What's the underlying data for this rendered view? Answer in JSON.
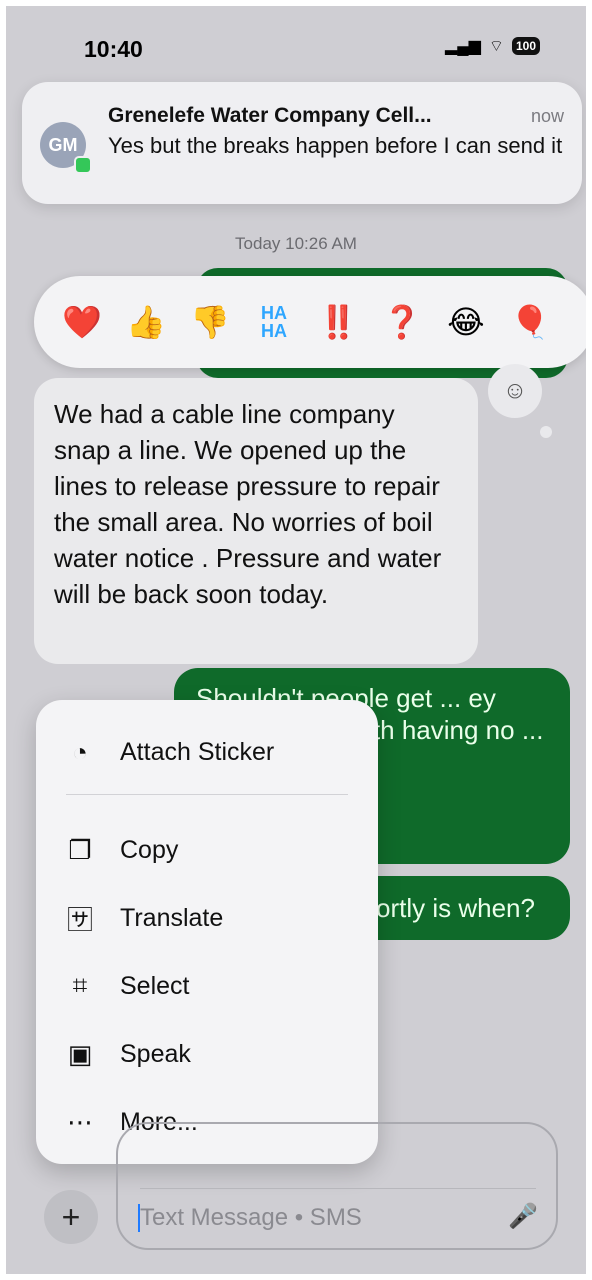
{
  "status_bar": {
    "time": "10:40",
    "battery": "100"
  },
  "notification": {
    "avatar_initials": "GM",
    "sender": "Grenelefe Water Company Cell...",
    "time": "now",
    "preview": "Yes but the breaks happen before I can send it"
  },
  "thread": {
    "day_stamp": "Today 10:26 AM",
    "incoming_message": "We had a cable line company snap a line. We opened up the lines to release pressure to repair the small area. No worries of boil water notice . Pressure and water will be back soon today.",
    "outgoing_message_1": "Shouldn't people get ... ey don't blow ... with having no ... them",
    "outgoing_message_2": "ortly is when?"
  },
  "reactions": [
    "❤️",
    "👍",
    "👎",
    "HA HA",
    "‼️",
    "❓",
    "😂",
    "🎈"
  ],
  "context_menu": {
    "items": [
      {
        "label": "Attach Sticker",
        "icon": "sticker-icon"
      },
      {
        "label": "Copy",
        "icon": "copy-icon"
      },
      {
        "label": "Translate",
        "icon": "translate-icon"
      },
      {
        "label": "Select",
        "icon": "select-icon"
      },
      {
        "label": "Speak",
        "icon": "speak-icon"
      },
      {
        "label": "More...",
        "icon": "more-icon"
      }
    ]
  },
  "composer": {
    "placeholder": "Text Message • SMS"
  }
}
